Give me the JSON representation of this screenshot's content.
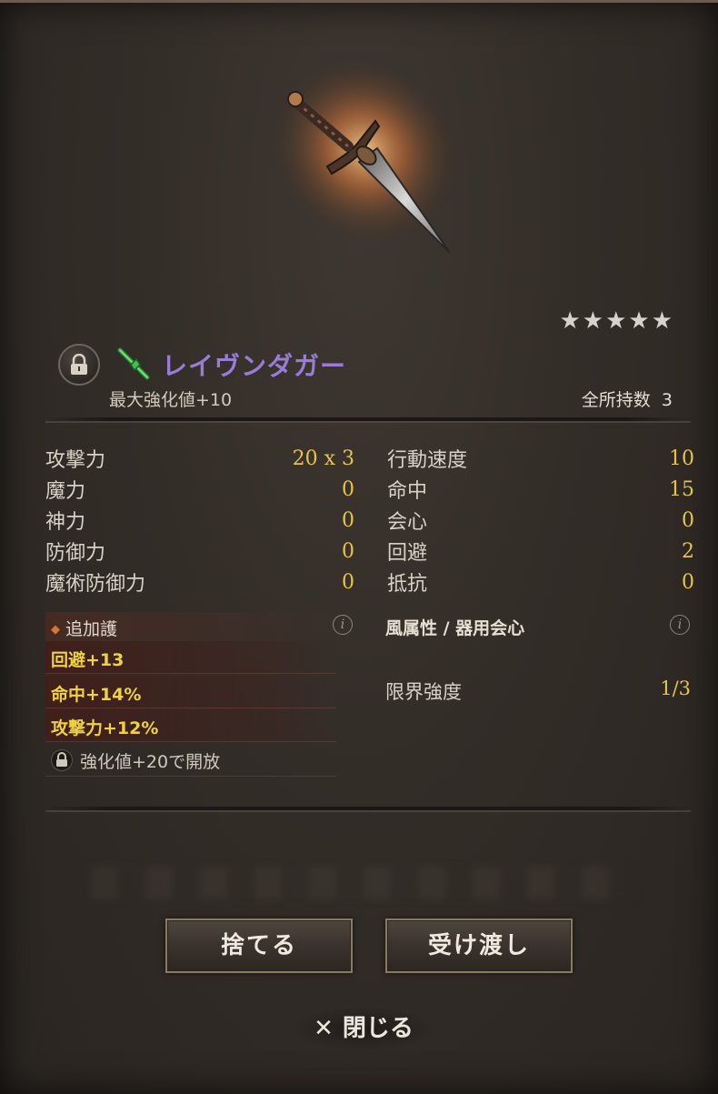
{
  "item": {
    "name": "レイヴンダガー",
    "rarity_stars": "★★★★★",
    "max_enhance": "最大強化値+10",
    "owned_label": "全所持数",
    "owned_count": "3",
    "name_color": "#9b7bd8"
  },
  "stats_left": [
    {
      "label": "攻撃力",
      "value": "20 x 3"
    },
    {
      "label": "魔力",
      "value": "0"
    },
    {
      "label": "神力",
      "value": "0"
    },
    {
      "label": "防御力",
      "value": "0"
    },
    {
      "label": "魔術防御力",
      "value": "0"
    }
  ],
  "stats_right": [
    {
      "label": "行動速度",
      "value": "10"
    },
    {
      "label": "命中",
      "value": "15"
    },
    {
      "label": "会心",
      "value": "0"
    },
    {
      "label": "回避",
      "value": "2"
    },
    {
      "label": "抵抗",
      "value": "0"
    }
  ],
  "bonus": {
    "title": "追加護",
    "rows": [
      "回避+13",
      "命中+14%",
      "攻撃力+12%"
    ],
    "locked": "強化値+20で開放"
  },
  "attribute": "風属性 / 器用会心",
  "limit": {
    "label": "限界強度",
    "value": "1/3"
  },
  "buttons": {
    "discard": "捨てる",
    "transfer": "受け渡し",
    "close": "閉じる"
  },
  "icons": {
    "lock": "lock-icon",
    "gem": "gem-icon",
    "info": "info-icon",
    "close": "close-icon"
  }
}
